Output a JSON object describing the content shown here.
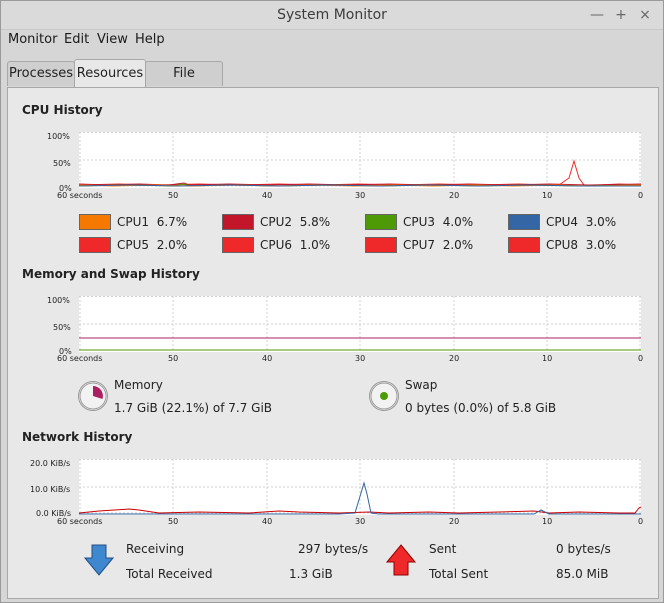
{
  "window": {
    "title": "System Monitor",
    "minimize_icon": "minimize-icon",
    "maximize_icon": "maximize-icon",
    "close_icon": "close-icon"
  },
  "menu": [
    "Monitor",
    "Edit",
    "View",
    "Help"
  ],
  "tabs": [
    {
      "label": "Processes",
      "active": false
    },
    {
      "label": "Resources",
      "active": true
    },
    {
      "label": "File Systems",
      "active": false
    }
  ],
  "cpu": {
    "title": "CPU History",
    "y_labels": [
      "100%",
      "50%",
      "0%"
    ],
    "x_labels": [
      "60 seconds",
      "50",
      "40",
      "30",
      "20",
      "10",
      "0"
    ],
    "legend": [
      {
        "label": "CPU1",
        "value": "6.7%",
        "color": "#f57900"
      },
      {
        "label": "CPU2",
        "value": "5.8%",
        "color": "#c4162a"
      },
      {
        "label": "CPU3",
        "value": "4.0%",
        "color": "#4e9a06"
      },
      {
        "label": "CPU4",
        "value": "3.0%",
        "color": "#3465a4"
      },
      {
        "label": "CPU5",
        "value": "2.0%",
        "color": "#ef2929"
      },
      {
        "label": "CPU6",
        "value": "1.0%",
        "color": "#ef2929"
      },
      {
        "label": "CPU7",
        "value": "2.0%",
        "color": "#ef2929"
      },
      {
        "label": "CPU8",
        "value": "3.0%",
        "color": "#ef2929"
      }
    ]
  },
  "memory": {
    "title": "Memory and Swap History",
    "y_labels": [
      "100%",
      "50%",
      "0%"
    ],
    "x_labels": [
      "60 seconds",
      "50",
      "40",
      "30",
      "20",
      "10",
      "0"
    ],
    "memory_label": "Memory",
    "memory_value": "1.7 GiB (22.1%) of 7.7 GiB",
    "memory_color": "#ad1f63",
    "swap_label": "Swap",
    "swap_value": "0 bytes (0.0%) of 5.8 GiB",
    "swap_color": "#4e9a06"
  },
  "network": {
    "title": "Network History",
    "y_labels": [
      "20.0 KiB/s",
      "10.0 KiB/s",
      "0.0 KiB/s"
    ],
    "x_labels": [
      "60 seconds",
      "50",
      "40",
      "30",
      "20",
      "10",
      "0"
    ],
    "receiving_label": "Receiving",
    "receiving_value": "297 bytes/s",
    "total_received_label": "Total Received",
    "total_received_value": "1.3 GiB",
    "sent_label": "Sent",
    "sent_value": "0 bytes/s",
    "total_sent_label": "Total Sent",
    "total_sent_value": "85.0 MiB",
    "receive_color": "#3465a4",
    "send_color": "#cc0000"
  }
}
